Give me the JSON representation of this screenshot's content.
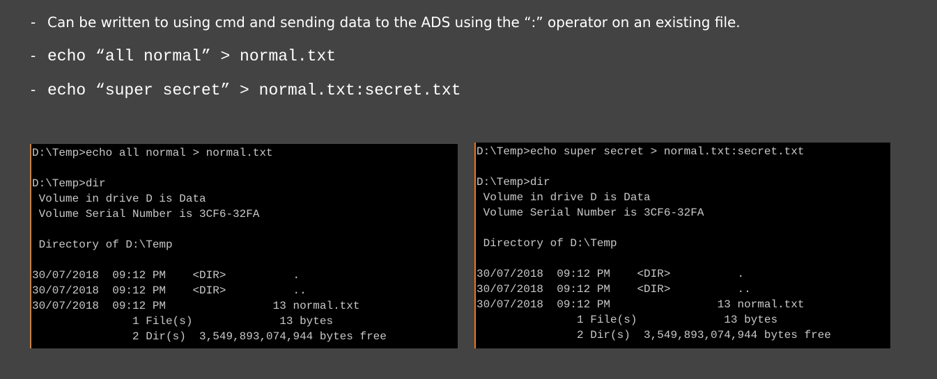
{
  "bullets": [
    {
      "dash": "-",
      "text": "Can be written to using cmd and sending data to the ADS using the “:” operator on an existing file."
    },
    {
      "dash": "-",
      "text": "echo “all normal” > normal.txt"
    },
    {
      "dash": "-",
      "text": "echo “super secret” > normal.txt:secret.txt"
    }
  ],
  "terminals": [
    {
      "lines": [
        "D:\\Temp>echo all normal > normal.txt",
        "",
        "D:\\Temp>dir",
        " Volume in drive D is Data",
        " Volume Serial Number is 3CF6-32FA",
        "",
        " Directory of D:\\Temp",
        "",
        "30/07/2018  09:12 PM    <DIR>          .",
        "30/07/2018  09:12 PM    <DIR>          ..",
        "30/07/2018  09:12 PM                13 normal.txt",
        "               1 File(s)             13 bytes",
        "               2 Dir(s)  3,549,893,074,944 bytes free"
      ]
    },
    {
      "lines": [
        "D:\\Temp>echo super secret > normal.txt:secret.txt",
        "",
        "D:\\Temp>dir",
        " Volume in drive D is Data",
        " Volume Serial Number is 3CF6-32FA",
        "",
        " Directory of D:\\Temp",
        "",
        "30/07/2018  09:12 PM    <DIR>          .",
        "30/07/2018  09:12 PM    <DIR>          ..",
        "30/07/2018  09:12 PM                13 normal.txt",
        "               1 File(s)             13 bytes",
        "               2 Dir(s)  3,549,893,074,944 bytes free"
      ]
    }
  ],
  "colors": {
    "background": "#434343",
    "terminal_bg": "#000000",
    "terminal_text": "#c8c8c8",
    "accent_border": "#e07a2a"
  }
}
